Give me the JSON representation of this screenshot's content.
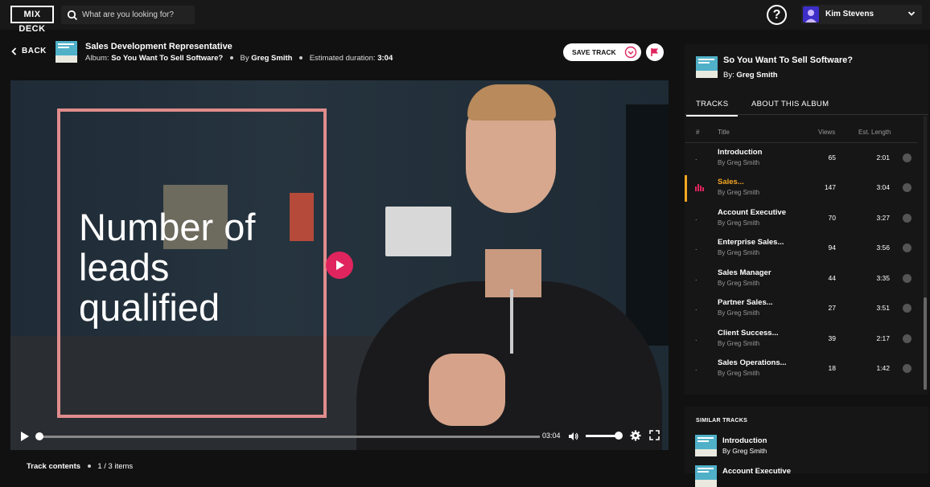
{
  "topbar": {
    "logo": "MIX DECK",
    "search_placeholder": "What are you looking for?",
    "help_symbol": "?",
    "user_name": "Kim Stevens"
  },
  "header": {
    "back_label": "BACK",
    "track_title": "Sales Development Representative",
    "album_prefix": "Album:",
    "album_name": "So You Want To Sell Software?",
    "by_prefix": "By",
    "author": "Greg Smith",
    "duration_prefix": "Estimated duration:",
    "duration": "3:04",
    "save_label": "SAVE TRACK"
  },
  "video": {
    "overlay_lines": [
      "Number of",
      "leads",
      "qualified"
    ],
    "time": "03:04",
    "progress": 0.0,
    "volume": 0.85
  },
  "contents": {
    "label": "Track contents",
    "count": "1 / 3 items"
  },
  "sidebar": {
    "album_title": "So You Want To Sell Software?",
    "by_prefix": "By:",
    "author": "Greg Smith",
    "tabs": [
      "TRACKS",
      "ABOUT THIS ALBUM"
    ],
    "columns": {
      "num": "#",
      "title": "Title",
      "views": "Views",
      "length": "Est. Length"
    },
    "tracks": [
      {
        "num": ".",
        "title": "Introduction",
        "by": "By Greg Smith",
        "views": "65",
        "length": "2:01"
      },
      {
        "num": "",
        "title": "Sales...",
        "by": "By Greg Smith",
        "views": "147",
        "length": "3:04"
      },
      {
        "num": ".",
        "title": "Account Executive",
        "by": "By Greg Smith",
        "views": "70",
        "length": "3:27"
      },
      {
        "num": ".",
        "title": "Enterprise Sales...",
        "by": "By Greg Smith",
        "views": "94",
        "length": "3:56"
      },
      {
        "num": ".",
        "title": "Sales Manager",
        "by": "By Greg Smith",
        "views": "44",
        "length": "3:35"
      },
      {
        "num": ".",
        "title": "Partner Sales...",
        "by": "By Greg Smith",
        "views": "27",
        "length": "3:51"
      },
      {
        "num": ".",
        "title": "Client Success...",
        "by": "By Greg Smith",
        "views": "39",
        "length": "2:17"
      },
      {
        "num": ".",
        "title": "Sales Operations...",
        "by": "By Greg Smith",
        "views": "18",
        "length": "1:42"
      }
    ]
  },
  "similar": {
    "heading": "SIMILAR TRACKS",
    "items": [
      {
        "title": "Introduction",
        "by": "By Greg Smith"
      },
      {
        "title": "Account Executive",
        "by": ""
      }
    ]
  },
  "colors": {
    "accent": "#e0245e",
    "active_track": "#f5a623",
    "overlay_box": "#e08c8c"
  }
}
